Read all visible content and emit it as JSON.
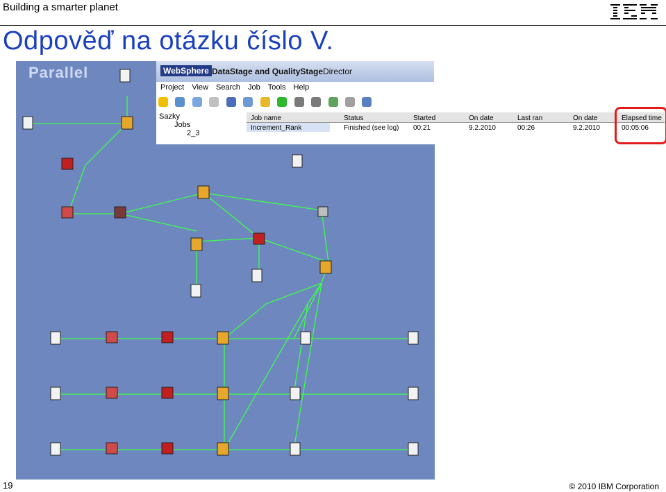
{
  "header": {
    "left_text": "Building a smarter planet",
    "logo_text": "IBM"
  },
  "title": "Odpověď na otázku číslo V.",
  "diagram": {
    "label": "Parallel"
  },
  "director": {
    "brand": "WebSphere",
    "product": "DataStage and QualityStage",
    "window": "Director",
    "menu": [
      "Project",
      "View",
      "Search",
      "Job",
      "Tools",
      "Help"
    ],
    "tree": [
      "Sazky",
      "Jobs",
      "2_3"
    ],
    "columns": [
      "Job name",
      "Status",
      "Started",
      "On date",
      "Last ran",
      "On date",
      "Elapsed time"
    ],
    "row": [
      "Increment_Rank",
      "Finished (see log)",
      "00:21",
      "9.2.2010",
      "00:26",
      "9.2.2010",
      "00:05:06"
    ]
  },
  "footer": {
    "page_number": "19",
    "copyright": "© 2010 IBM Corporation"
  },
  "colors": {
    "title": "#1a3fbf",
    "diagram_bg": "#6e88bf",
    "link": "#3cff4a",
    "highlight": "#e41b1b"
  }
}
